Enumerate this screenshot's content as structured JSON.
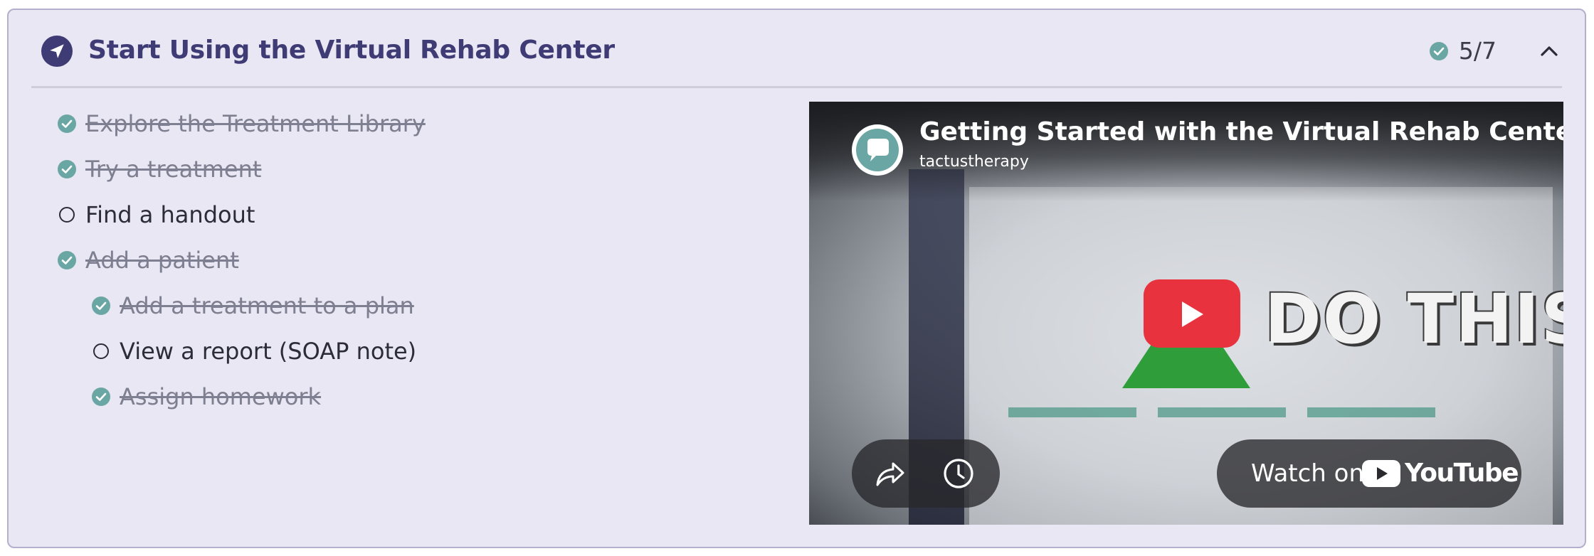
{
  "header": {
    "title": "Start Using the Virtual Rehab Center",
    "progress": "5/7",
    "rocket_icon": "rocket-icon",
    "check_icon": "check-circle-icon",
    "collapse_icon": "chevron-up-icon"
  },
  "tasks": [
    {
      "label": "Explore the Treatment Library",
      "done": true,
      "indent": 0
    },
    {
      "label": "Try a treatment",
      "done": true,
      "indent": 0
    },
    {
      "label": "Find a handout",
      "done": false,
      "indent": 0
    },
    {
      "label": "Add a patient",
      "done": true,
      "indent": 0
    },
    {
      "label": "Add a treatment to a plan",
      "done": true,
      "indent": 1
    },
    {
      "label": "View a report (SOAP note)",
      "done": false,
      "indent": 1
    },
    {
      "label": "Assign homework",
      "done": true,
      "indent": 1
    }
  ],
  "video": {
    "title": "Getting Started with the Virtual Rehab Center",
    "channel": "tactustherapy",
    "overlay_text": "DO THIS",
    "watch_on": "Watch on",
    "youtube_word": "YouTube",
    "icons": [
      "share-icon",
      "clock-icon",
      "play-icon",
      "youtube-logo-icon"
    ]
  },
  "colors": {
    "accent": "#3e3b75",
    "check": "#6aa6a4",
    "card_bg": "#e9e7f3",
    "play_red": "#e8323e"
  }
}
